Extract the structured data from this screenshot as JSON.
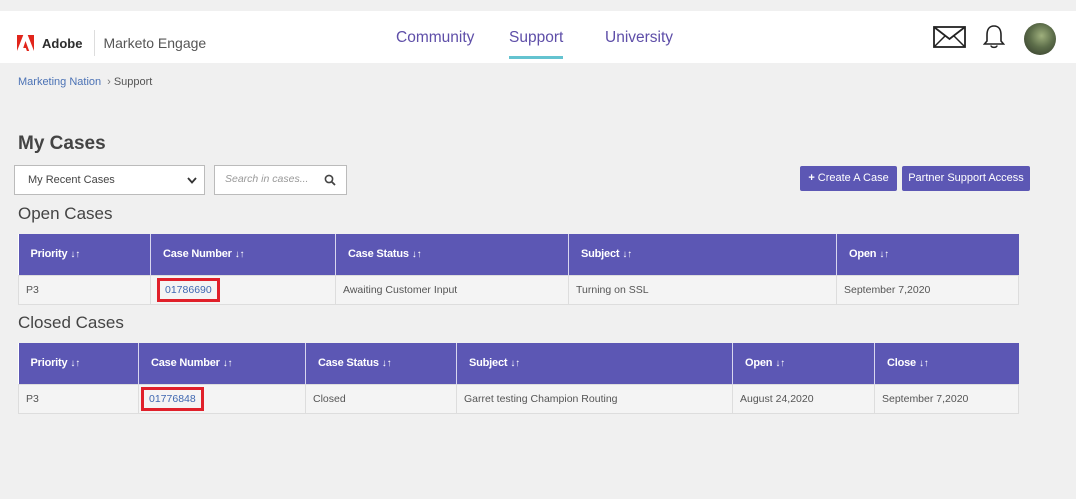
{
  "header": {
    "brand": "Adobe",
    "product": "Marketo Engage",
    "nav": [
      {
        "label": "Community"
      },
      {
        "label": "Support"
      },
      {
        "label": "University"
      }
    ],
    "active_nav": "Support",
    "icons": [
      "mail-icon",
      "bell-icon",
      "avatar"
    ]
  },
  "breadcrumb": {
    "root": "Marketing Nation",
    "current": "Support"
  },
  "page_title": "My Cases",
  "filter": {
    "selected": "My Recent Cases",
    "search_placeholder": "Search in cases..."
  },
  "buttons": {
    "create": "Create A Case",
    "partner": "Partner Support Access"
  },
  "open_cases": {
    "title": "Open Cases",
    "columns": [
      "Priority",
      "Case Number",
      "Case Status",
      "Subject",
      "Open"
    ],
    "rows": [
      {
        "priority": "P3",
        "case_number": "01786690",
        "status": "Awaiting Customer Input",
        "subject": "Turning on SSL",
        "open": "September 7,2020"
      }
    ]
  },
  "closed_cases": {
    "title": "Closed Cases",
    "columns": [
      "Priority",
      "Case Number",
      "Case Status",
      "Subject",
      "Open",
      "Close"
    ],
    "rows": [
      {
        "priority": "P3",
        "case_number": "01776848",
        "status": "Closed",
        "subject": "Garret testing Champion Routing",
        "open": "August 24,2020",
        "close": "September 7,2020"
      }
    ]
  },
  "colors": {
    "accent": "#5c57b4",
    "nav_text": "#5e4ea8",
    "nav_underline": "#64c3d0",
    "highlight": "#e0202a"
  }
}
